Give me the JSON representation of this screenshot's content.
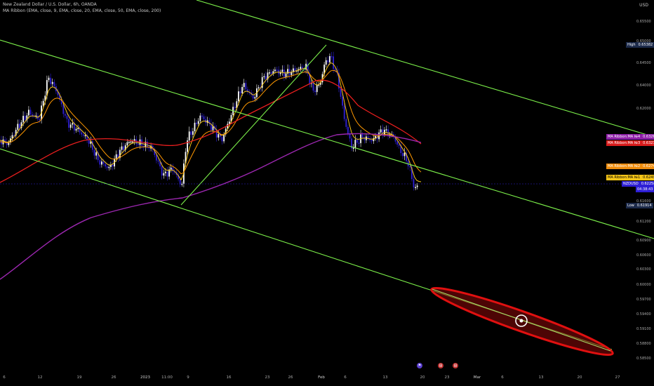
{
  "header": {
    "title": "New Zealand Dollar / U.S. Dollar, 6h, OANDA",
    "indicator": "MA Ribbon (EMA, close, 9, EMA, close, 20, EMA, close, 50, EMA, close, 200)"
  },
  "price_axis": {
    "currency": "USD",
    "labels": [
      "0.65500",
      "0.65000",
      "0.64500",
      "0.64000",
      "0.62000",
      "0.61600",
      "0.61200",
      "0.60900",
      "0.60600",
      "0.60300",
      "0.60000",
      "0.59700",
      "0.59400",
      "0.59100",
      "0.58800",
      "0.58500"
    ]
  },
  "tags": {
    "high": {
      "label": "High",
      "value": "0.65382"
    },
    "ma4": {
      "label": "MA Ribbon:MA №4",
      "value": "0.63265"
    },
    "ma3": {
      "label": "MA Ribbon:MA №3",
      "value": "0.63233"
    },
    "ma2": {
      "label": "MA Ribbon:MA №2",
      "value": "0.62746"
    },
    "ma1": {
      "label": "MA Ribbon:MA №1",
      "value": "0.62497"
    },
    "symbol": {
      "label": "NZDUSD",
      "value": "0.62258",
      "countdown": "04:38:43"
    },
    "low": {
      "label": "Low",
      "value": "0.61914"
    }
  },
  "time_axis": [
    "6",
    "12",
    "19",
    "26",
    "2023",
    "11:00",
    "9",
    "16",
    "23",
    "26",
    "Feb",
    "6",
    "13",
    "20",
    "23",
    "Mar",
    "6",
    "13",
    "20",
    "27"
  ],
  "events": [
    "flag-icon",
    "us-flag-icon",
    "us-flag-icon"
  ],
  "colors": {
    "background": "#000000",
    "candle_up": "#ffffff",
    "candle_down": "#2e1fd6",
    "ma1": "#f5c518",
    "ma2": "#ff9800",
    "ma3": "#e91e1e",
    "ma4": "#9c27b0",
    "channel": "#7cf04a",
    "ellipse": "#e01010"
  },
  "chart_data": {
    "type": "candlestick",
    "symbol": "NZDUSD",
    "interval": "6h",
    "ylim": [
      0.585,
      0.658
    ],
    "overlays": [
      "EMA 9",
      "EMA 20",
      "EMA 50",
      "EMA 200",
      "parallel channel",
      "trend line",
      "ellipse"
    ],
    "last_price": 0.62258,
    "high": 0.65382,
    "low": 0.61914
  }
}
